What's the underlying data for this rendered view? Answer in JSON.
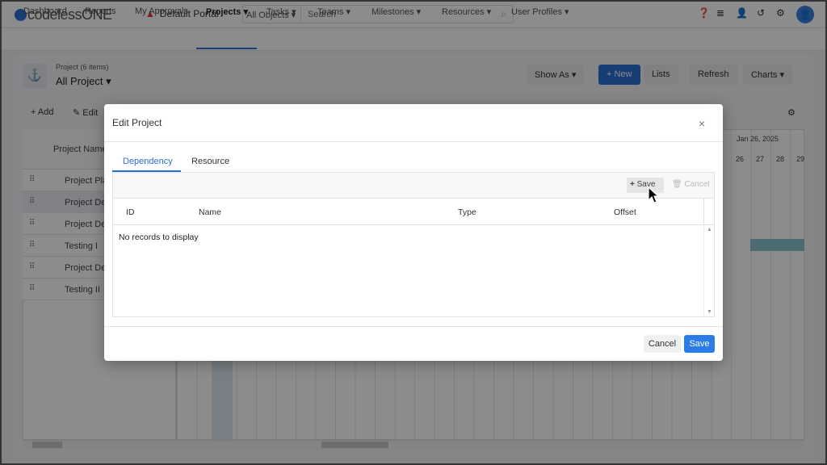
{
  "header": {
    "logo": "codelessONE",
    "portal": "Default Portal",
    "search_scope": "All Objects",
    "search_placeholder": "Search",
    "icons": [
      "help-icon",
      "database-icon",
      "add-user-icon",
      "history-icon",
      "gear-icon",
      "avatar-icon"
    ]
  },
  "nav": {
    "items": [
      {
        "label": "Dashboard"
      },
      {
        "label": "Reports"
      },
      {
        "label": "My Approvals"
      },
      {
        "label": "Projects ▾"
      },
      {
        "label": "Tasks ▾"
      },
      {
        "label": "Teams ▾"
      },
      {
        "label": "Milestones ▾"
      },
      {
        "label": "Resources ▾"
      },
      {
        "label": "User Profiles ▾"
      }
    ],
    "active": "Projects"
  },
  "page": {
    "subtitle": "Project (6 items)",
    "title": "All Project ▾",
    "buttons": {
      "show_as": "Show As ▾",
      "new": "+ New",
      "lists": "Lists",
      "refresh": "Refresh",
      "charts": "Charts ▾"
    },
    "toolbar": {
      "add": "+ Add",
      "edit": "Edit"
    },
    "grid": {
      "column": "Project Name",
      "rows": [
        "Project Pla",
        "Project Des",
        "Project Dev",
        "Testing I",
        "Project Dev",
        "Testing II"
      ]
    },
    "gantt": {
      "week": "Jan 26, 2025",
      "days": [
        "26",
        "27",
        "28",
        "29"
      ]
    }
  },
  "modal": {
    "title": "Edit Project",
    "close": "×",
    "tabs": [
      {
        "label": "Dependency",
        "active": true
      },
      {
        "label": "Resource",
        "active": false
      }
    ],
    "grid": {
      "save": "Save",
      "cancel": "Cancel",
      "columns": [
        "ID",
        "Name",
        "Type",
        "Offset"
      ],
      "empty": "No records to display"
    },
    "footer": {
      "cancel": "Cancel",
      "save": "Save"
    }
  },
  "colors": {
    "accent": "#2a6fd6",
    "primary_button": "#2a7de9"
  }
}
